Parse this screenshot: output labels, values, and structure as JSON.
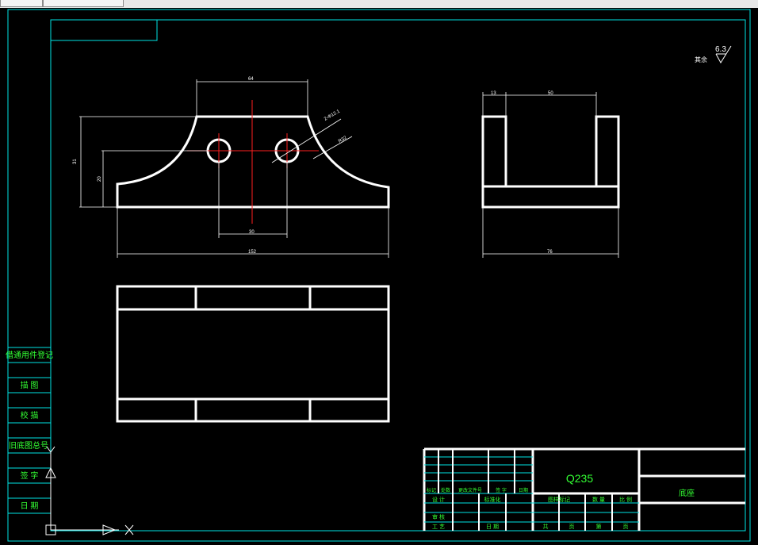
{
  "window": {
    "tabs": [
      "",
      ""
    ]
  },
  "colors": {
    "background": "#000000",
    "frame": "#00e5e5",
    "geometry": "#ffffff",
    "centerline": "#ff2020",
    "text": "#33ff33"
  },
  "roughness": {
    "prefix": "其余",
    "value": "6.3"
  },
  "front_view": {
    "dim_top": "64",
    "dim_holes": "2-Φ12.1",
    "dim_radius": "R32",
    "dim_height_total": "31",
    "dim_height_center": "20",
    "dim_hole_spacing": "30",
    "dim_width": "152"
  },
  "side_view": {
    "dim_left": "13",
    "dim_inner": "50",
    "dim_width": "76"
  },
  "left_strip": [
    "借通用件登记",
    "描 图",
    "校 描",
    "旧底图总号",
    "签 字",
    "日 期"
  ],
  "title_block": {
    "material": "Q235",
    "part_name": "底座",
    "rev_headers": [
      "标记",
      "处数",
      "更改文件号",
      "签 字",
      "日期"
    ],
    "rows": [
      "设 计",
      "审 核",
      "工 艺"
    ],
    "row_labels_mid": [
      "标准化",
      "日 期"
    ],
    "stage_header": [
      "图样标记",
      "数 量",
      "比 例"
    ],
    "sheet_line": [
      "共",
      "页",
      "第",
      "页"
    ]
  },
  "ucs": {
    "y_label": "Y",
    "x_label": "X"
  }
}
